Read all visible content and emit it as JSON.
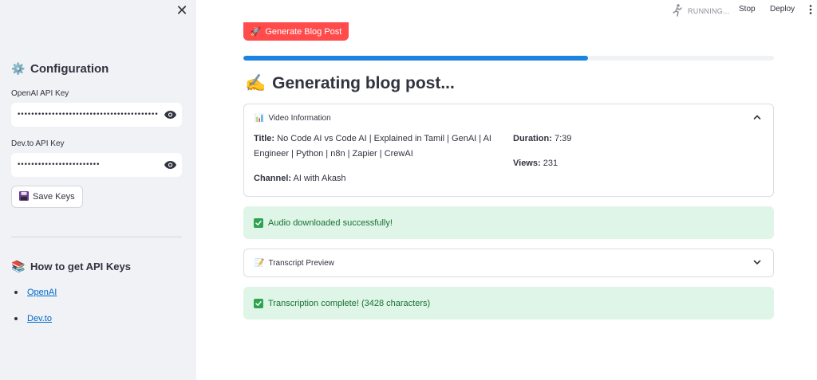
{
  "sidebar": {
    "config_title": "Configuration",
    "openai_label": "OpenAI API Key",
    "openai_value": "••••••••••••••••••••••••••••••••••••••••••••••••••",
    "devto_label": "Dev.to API Key",
    "devto_value": "••••••••••••••••••••••••",
    "save_label": "Save Keys",
    "howto_title": "How to get API Keys",
    "links": [
      "OpenAI",
      "Dev.to"
    ]
  },
  "header": {
    "status": "RUNNING...",
    "stop_label": "Stop",
    "deploy_label": "Deploy"
  },
  "main": {
    "generate_label": "Generate Blog Post",
    "progress": 0.65,
    "title": "Generating blog post...",
    "video_info": {
      "label": "Video Information",
      "title_key": "Title:",
      "title_value": "No Code AI vs Code AI | Explained in Tamil | GenAI | AI Engineer | Python | n8n | Zapier | CrewAI",
      "channel_key": "Channel:",
      "channel_value": "AI with Akash",
      "duration_key": "Duration:",
      "duration_value": "7:39",
      "views_key": "Views:",
      "views_value": "231"
    },
    "audio_alert": "Audio downloaded successfully!",
    "transcript_label": "Transcript Preview",
    "transcription_alert": "Transcription complete! (3428 characters)"
  },
  "colors": {
    "primary": "#ff4b4b",
    "progress": "#1c83e1",
    "success_bg": "#dff5e7",
    "success_text": "#177233",
    "link": "#0068c9",
    "sidebar_bg": "#f0f2f6"
  }
}
